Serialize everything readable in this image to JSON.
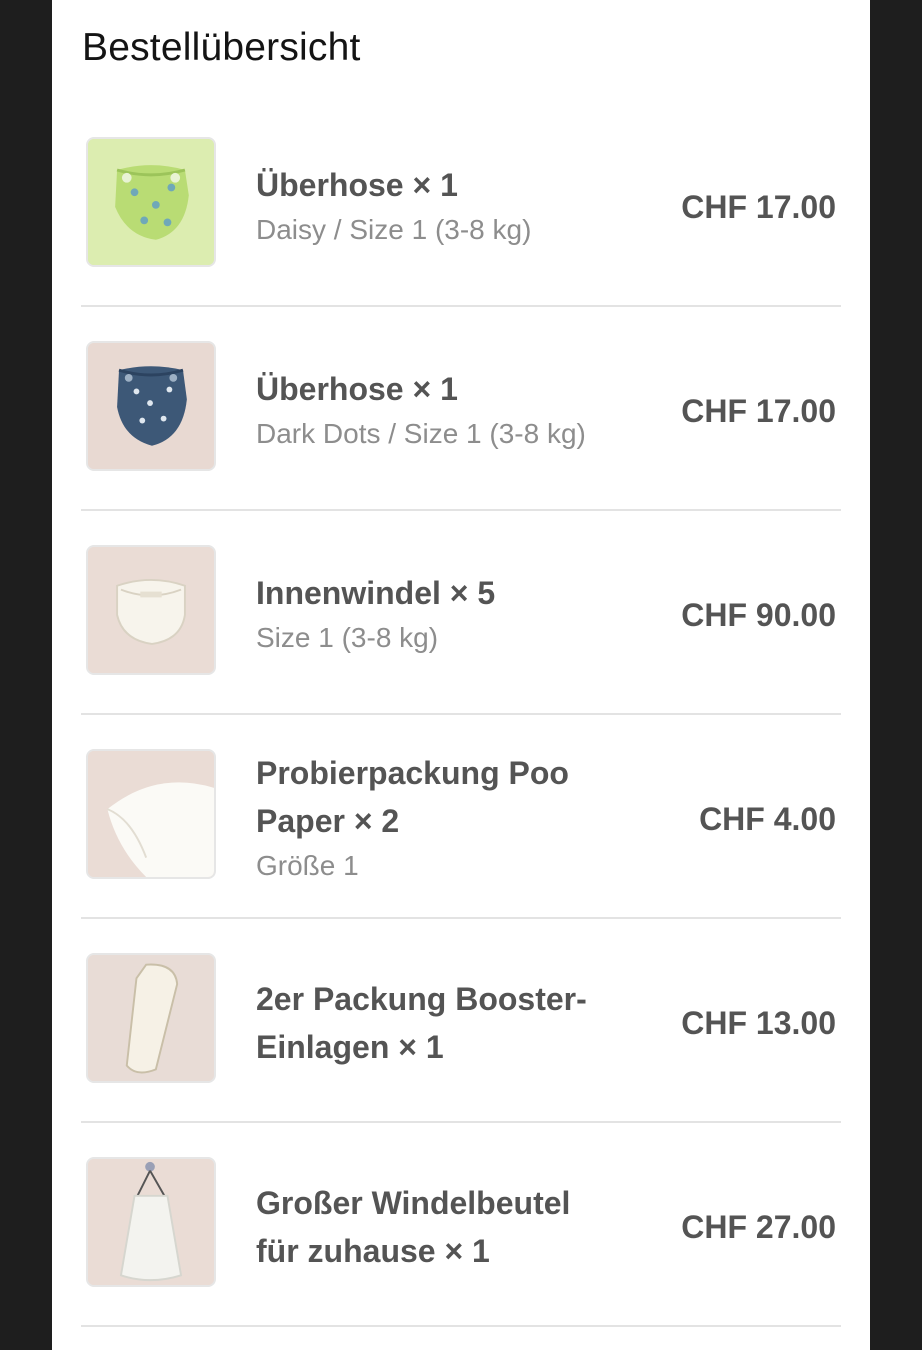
{
  "page": {
    "title": "Bestellübersicht"
  },
  "items": [
    {
      "name": "Überhose × 1",
      "variant": "Daisy / Size 1 (3-8 kg)",
      "price": "CHF 17.00",
      "image": "green-daisy-cloth-diaper-cover",
      "bg": "#dcedb0"
    },
    {
      "name": "Überhose × 1",
      "variant": "Dark Dots / Size 1 (3-8 kg)",
      "price": "CHF 17.00",
      "image": "dark-blue-dotted-cloth-diaper-cover",
      "bg": "#e8d9d2"
    },
    {
      "name": "Innenwindel × 5",
      "variant": "Size 1 (3-8 kg)",
      "price": "CHF 90.00",
      "image": "white-inner-diaper",
      "bg": "#eadcd5"
    },
    {
      "name_line1": "Probierpackung Poo",
      "name_line2": "Paper × 2",
      "variant": "Größe 1",
      "price": "CHF 4.00",
      "image": "liner-paper-sheets",
      "bg": "#eadcd5"
    },
    {
      "name_line1": "2er Packung Booster-",
      "name_line2": "Einlagen × 1",
      "price": "CHF 13.00",
      "image": "booster-insert",
      "bg": "#e8dcd6"
    },
    {
      "name_line1": "Großer Windelbeutel",
      "name_line2": "für zuhause × 1",
      "price": "CHF 27.00",
      "image": "hanging-diaper-bag",
      "bg": "#eadcd5"
    }
  ]
}
